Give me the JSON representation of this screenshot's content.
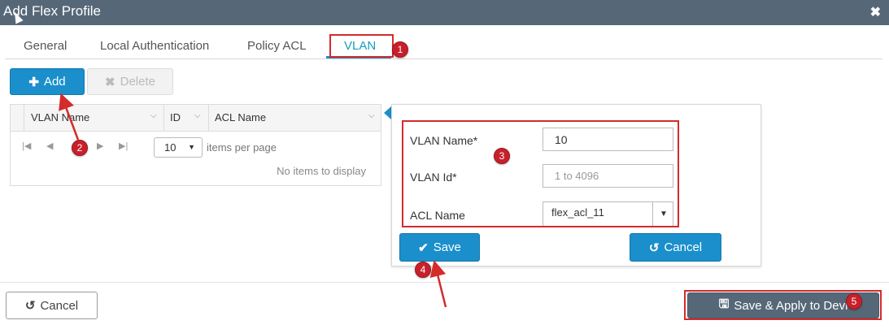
{
  "dialog": {
    "title": "Add Flex Profile",
    "close_icon": "close-icon"
  },
  "tabs": [
    {
      "label": "General"
    },
    {
      "label": "Local Authentication"
    },
    {
      "label": "Policy ACL"
    },
    {
      "label": "VLAN",
      "active": true
    }
  ],
  "toolbar": {
    "add_label": "Add",
    "delete_label": "Delete"
  },
  "grid": {
    "columns": [
      "VLAN Name",
      "ID",
      "ACL Name"
    ],
    "per_page": "10",
    "per_page_label": "items per page",
    "empty_text": "No items to display"
  },
  "form": {
    "vlan_name_label": "VLAN Name*",
    "vlan_name_value": "10",
    "vlan_id_label": "VLAN Id*",
    "vlan_id_placeholder": "1 to 4096",
    "acl_name_label": "ACL Name",
    "acl_name_value": "flex_acl_11",
    "save_label": "Save",
    "cancel_label": "Cancel"
  },
  "footer": {
    "cancel_label": "Cancel",
    "apply_label": "Save & Apply to Devi"
  },
  "annotations": [
    "1",
    "2",
    "3",
    "4",
    "5"
  ],
  "colors": {
    "accent": "#1a8fcb",
    "title_bar": "#566878",
    "highlight": "#d42b2b",
    "badge": "#c8202b",
    "active_tab": "#14a0b8"
  }
}
